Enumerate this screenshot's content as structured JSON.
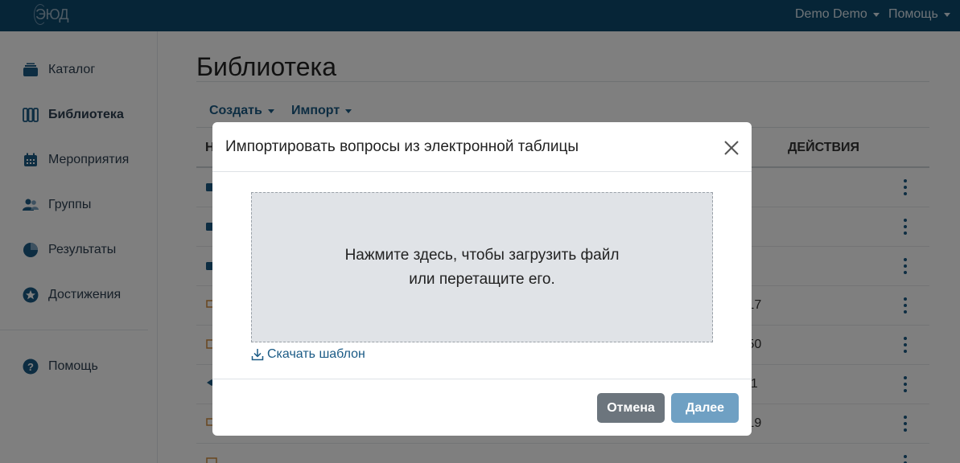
{
  "topbar": {
    "logo": "ЭЮД",
    "user_menu": "Demo Demo",
    "help_menu": "Помощь"
  },
  "sidebar": {
    "items": [
      {
        "label": "Каталог"
      },
      {
        "label": "Библиотека"
      },
      {
        "label": "Мероприятия"
      },
      {
        "label": "Группы"
      },
      {
        "label": "Результаты"
      },
      {
        "label": "Достижения"
      },
      {
        "label": "Помощь"
      }
    ]
  },
  "main": {
    "title": "Библиотека",
    "toolbar": {
      "create": "Создать",
      "import": "Импорт"
    },
    "table": {
      "col_name_partial": "Н",
      "col_actions": "ДЕЙСТВИЯ",
      "rows": [
        {
          "time": ""
        },
        {
          "time": ""
        },
        {
          "time": ""
        },
        {
          "time": ":17"
        },
        {
          "time": ":50"
        },
        {
          "time": "31"
        },
        {
          "time": ":19"
        },
        {
          "time": ""
        }
      ]
    }
  },
  "modal": {
    "title": "Импортировать вопросы из электронной таблицы",
    "dropzone_line1": "Нажмите здесь, чтобы загрузить файл",
    "dropzone_line2": "или перетащите его.",
    "template_link": "Скачать шаблон",
    "cancel": "Отмена",
    "next": "Далее"
  },
  "colors": {
    "topbar": "#0c4a6e",
    "accent": "#1a5a85",
    "cancel_button": "#6c757d",
    "next_button": "#6fa0c3",
    "dropzone": "#e0e3e7"
  }
}
